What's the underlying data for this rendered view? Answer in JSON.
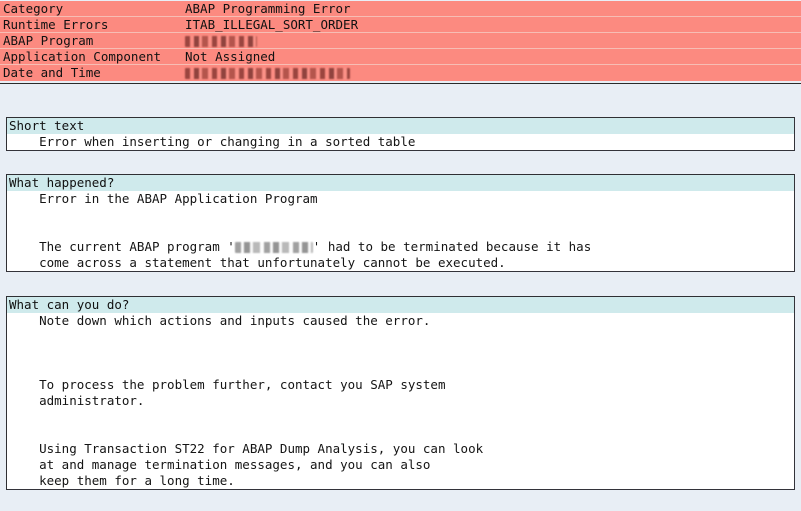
{
  "header": {
    "rows": [
      {
        "label": "Category",
        "value": "ABAP Programming Error",
        "redacted": false
      },
      {
        "label": "Runtime Errors",
        "value": "ITAB_ILLEGAL_SORT_ORDER",
        "redacted": false
      },
      {
        "label": "ABAP Program",
        "value": "",
        "redacted": true,
        "redaction": "program-name"
      },
      {
        "label": "Application Component",
        "value": "Not Assigned",
        "redacted": false
      },
      {
        "label": "Date and Time",
        "value": "",
        "redacted": true,
        "redaction": "date-time"
      }
    ]
  },
  "sections": [
    {
      "id": "short-text",
      "title": "Short text",
      "lines": [
        "    Error when inserting or changing in a sorted table"
      ]
    },
    {
      "id": "what-happened",
      "title": "What happened?",
      "lines": [
        "    Error in the ABAP Application Program",
        "",
        "",
        "    The current ABAP program '",
        "    come across a statement that unfortunately cannot be executed."
      ],
      "inline_redacted_line_prefix": "    The current ABAP program '",
      "inline_redacted_line_suffix": "' had to be terminated because it has"
    },
    {
      "id": "what-can-you-do",
      "title": "What can you do?",
      "lines": [
        "    Note down which actions and inputs caused the error.",
        "",
        "",
        "",
        "    To process the problem further, contact you SAP system",
        "    administrator.",
        "",
        "",
        "    Using Transaction ST22 for ABAP Dump Analysis, you can look",
        "    at and manage termination messages, and you can also",
        "    keep them for a long time."
      ]
    }
  ],
  "colors": {
    "header_background": "#fc8a80",
    "header_separator": "#f7bdb4",
    "panel_title_background": "#cfeaec",
    "page_background": "#e8eef5",
    "panel_border": "#2f2f33",
    "text": "#141414"
  }
}
